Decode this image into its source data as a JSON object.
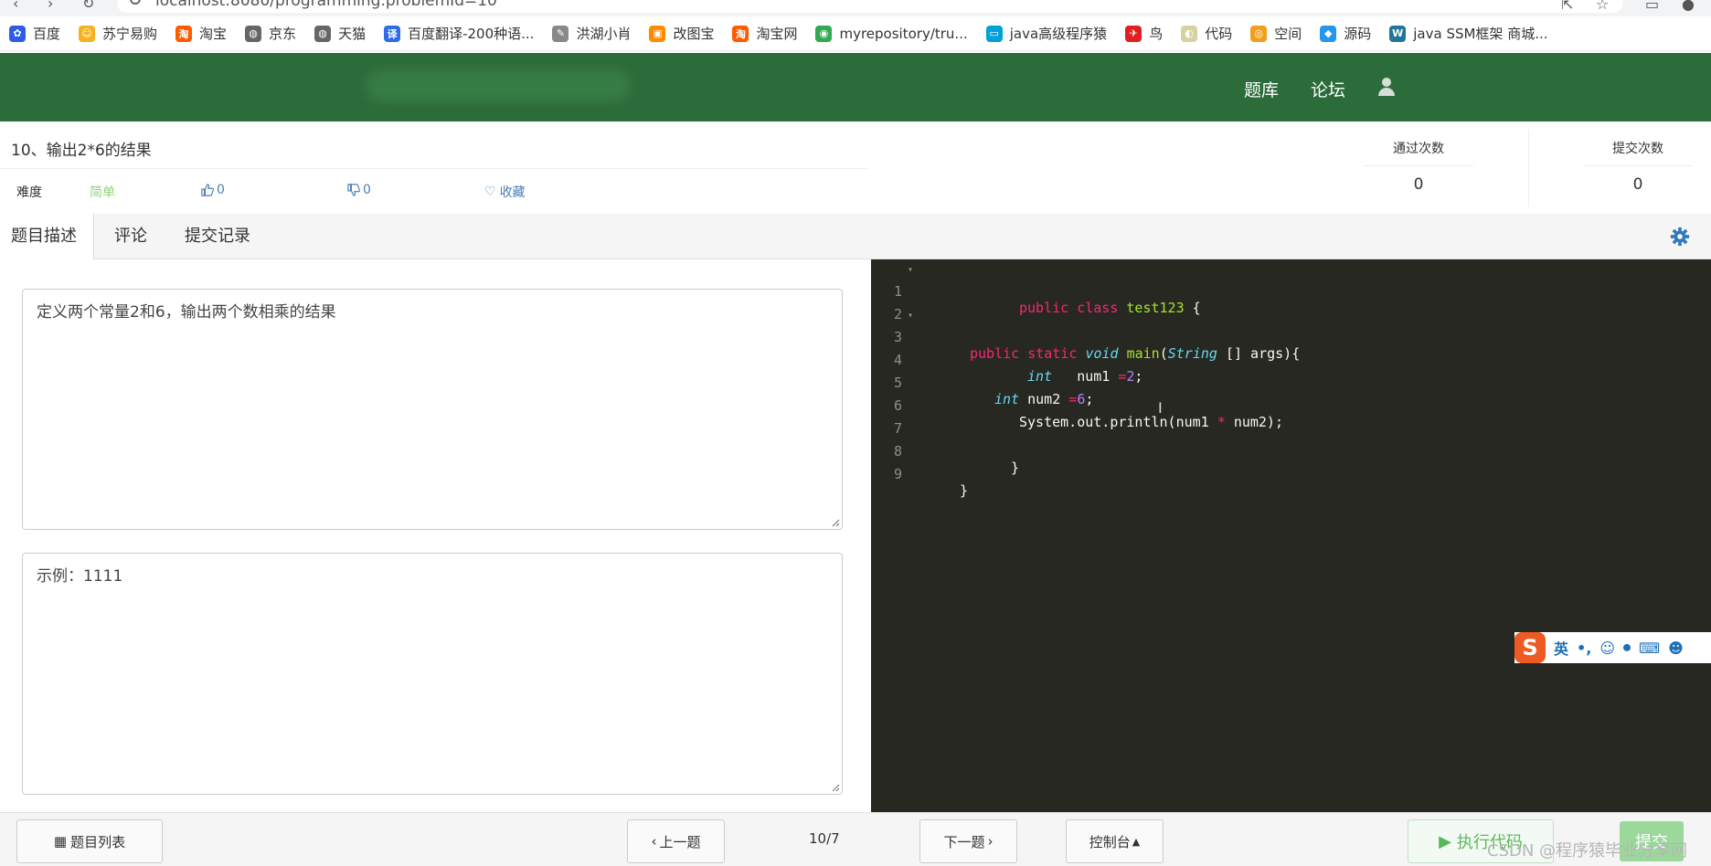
{
  "browser": {
    "url": "localhost:8080/programming.problemId=10",
    "bookmarks": [
      {
        "label": "百度",
        "color": "#2e5ce6",
        "glyph": "✿"
      },
      {
        "label": "苏宁易购",
        "color": "#f5b21e",
        "glyph": "☺"
      },
      {
        "label": "淘宝",
        "color": "#ff5a00",
        "glyph": "淘"
      },
      {
        "label": "京东",
        "color": "#666666",
        "glyph": "◍"
      },
      {
        "label": "天猫",
        "color": "#666666",
        "glyph": "◍"
      },
      {
        "label": "百度翻译-200种语...",
        "color": "#2e6be6",
        "glyph": "译"
      },
      {
        "label": "洪湖小肖",
        "color": "#888888",
        "glyph": "✎"
      },
      {
        "label": "改图宝",
        "color": "#ff8a00",
        "glyph": "▣"
      },
      {
        "label": "淘宝网",
        "color": "#ff5a00",
        "glyph": "淘"
      },
      {
        "label": "myrepository/tru...",
        "color": "#34a853",
        "glyph": "◉"
      },
      {
        "label": "java高级程序猿",
        "color": "#00a1d6",
        "glyph": "▭"
      },
      {
        "label": "鸟",
        "color": "#e02020",
        "glyph": "✈"
      },
      {
        "label": "代码",
        "color": "#d8d2a0",
        "glyph": "◐"
      },
      {
        "label": "空间",
        "color": "#f0a020",
        "glyph": "◎"
      },
      {
        "label": "源码",
        "color": "#2496ed",
        "glyph": "◆"
      },
      {
        "label": "java SSM框架 商城...",
        "color": "#21759b",
        "glyph": "W"
      }
    ]
  },
  "header": {
    "nav": [
      "题库",
      "论坛"
    ],
    "colors": {
      "bg": "#2c6b3a"
    }
  },
  "problem": {
    "title": "10、输出2*6的结果",
    "difficulty_label": "难度",
    "difficulty": "简单",
    "likes": "0",
    "dislikes": "0",
    "favorite": "收藏",
    "pass_label": "通过次数",
    "pass_count": "0",
    "submit_label": "提交次数",
    "submit_count": "0"
  },
  "tabs": [
    "题目描述",
    "评论",
    "提交记录"
  ],
  "description": "定义两个常量2和6，输出两个数相乘的结果",
  "example": "示例：1111",
  "editor": {
    "line_numbers": [
      "1",
      "2",
      "3",
      "4",
      "5",
      "6",
      "7",
      "8",
      "9"
    ]
  },
  "ime": {
    "logo": "S",
    "lang": "英"
  },
  "toolbar": {
    "list": "题目列表",
    "prev": "上一题",
    "page": "10/7",
    "next": "下一题",
    "console": "控制台",
    "run": "执行代码",
    "submit": "提交"
  },
  "watermark": "CSDN @程序猿毕业分享网"
}
